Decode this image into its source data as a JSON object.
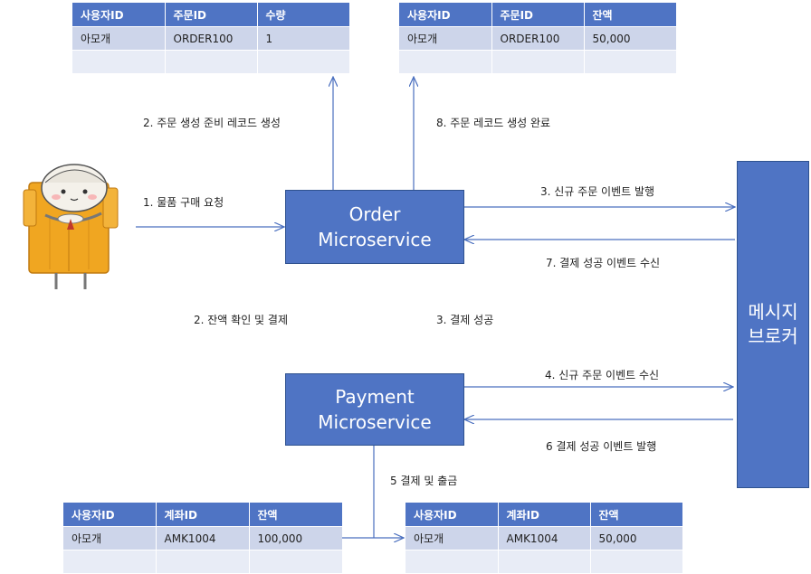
{
  "table_top_left": {
    "headers": [
      "사용자ID",
      "주문ID",
      "수량"
    ],
    "rows": [
      [
        "아모개",
        "ORDER100",
        "1"
      ],
      [
        "",
        "",
        ""
      ]
    ]
  },
  "table_top_right": {
    "headers": [
      "사용자ID",
      "주문ID",
      "잔액"
    ],
    "rows": [
      [
        "아모개",
        "ORDER100",
        "50,000"
      ],
      [
        "",
        "",
        ""
      ]
    ]
  },
  "table_bottom_left": {
    "headers": [
      "사용자ID",
      "계좌ID",
      "잔액"
    ],
    "rows": [
      [
        "아모개",
        "AMK1004",
        "100,000"
      ],
      [
        "",
        "",
        ""
      ]
    ]
  },
  "table_bottom_right": {
    "headers": [
      "사용자ID",
      "계좌ID",
      "잔액"
    ],
    "rows": [
      [
        "아모개",
        "AMK1004",
        "50,000"
      ],
      [
        "",
        "",
        ""
      ]
    ]
  },
  "nodes": {
    "order_service": {
      "line1": "Order",
      "line2": "Microservice"
    },
    "payment_service": {
      "line1": "Payment",
      "line2": "Microservice"
    },
    "broker": {
      "line1": "메시지",
      "line2": "브로커"
    }
  },
  "labels": {
    "create_order_record": "2. 주문 생성 준비 레코드 생성",
    "order_record_complete": "8. 주문 레코드 생성 완료",
    "purchase_request": "1. 물품 구매 요청",
    "publish_new_order": "3. 신규 주문 이벤트 발행",
    "receive_payment_success": "7. 결제 성공 이벤트 수신",
    "check_balance_pay": "2. 잔액 확인 및 결제",
    "payment_success": "3. 결제 성공",
    "receive_new_order": "4. 신규 주문 이벤트 수신",
    "publish_payment_success": "6 결제 성공 이벤트 발행",
    "pay_and_withdraw": "5 결제 및 출금"
  },
  "colors": {
    "node_fill": "#4f74c4",
    "table_header": "#4f74c4",
    "row_fill_1": "#cdd5ea",
    "row_fill_2": "#e8ecf6",
    "arrow": "#4a6fbf"
  }
}
